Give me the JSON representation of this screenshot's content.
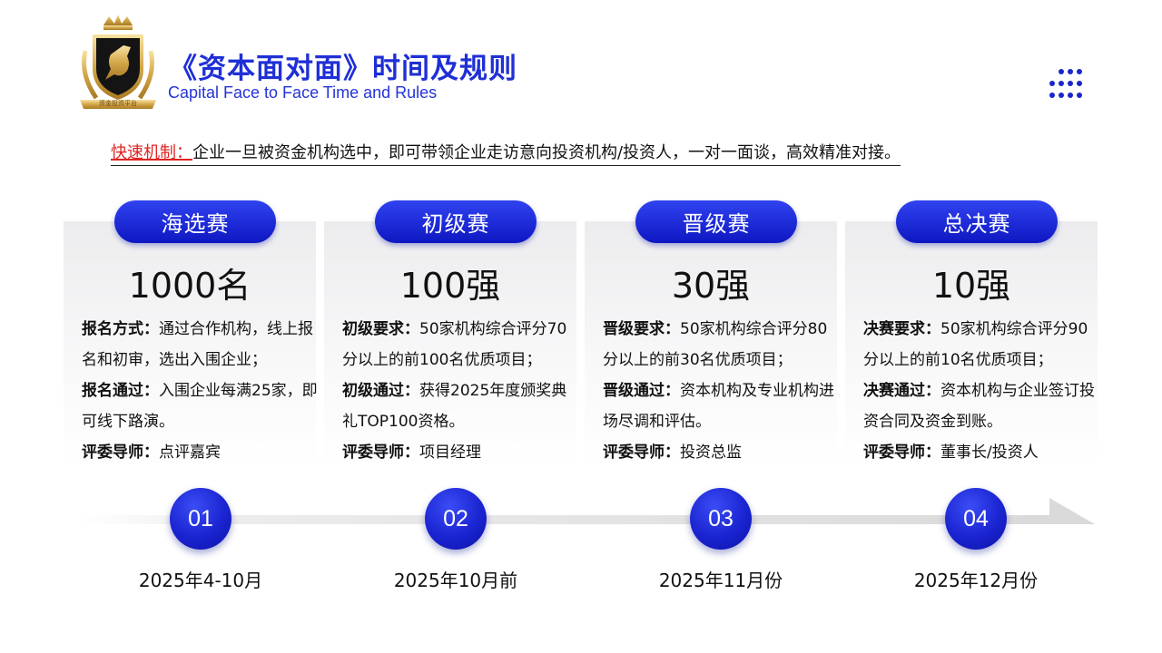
{
  "header": {
    "title": "《资本面对面》时间及规则",
    "subtitle": "Capital Face to Face Time and Rules",
    "logo_text": "资金投资平台"
  },
  "intro": {
    "label": "快速机制：",
    "text": "企业一旦被资金机构选中，即可带领企业走访意向投资机构/投资人，一对一面谈，高效精准对接。"
  },
  "colors": {
    "accent": "#1f2fd6",
    "pill": "#1a26c9",
    "highlight": "#e02424"
  },
  "stages": [
    {
      "name": "海选赛",
      "count": "1000名",
      "lines": [
        {
          "label": "报名方式：",
          "text": "通过合作机构，线上报名和初审，选出入围企业；"
        },
        {
          "label": "报名通过：",
          "text": "入围企业每满25家，即可线下路演。"
        },
        {
          "label": "评委导师：",
          "text": "点评嘉宾"
        }
      ],
      "number": "01",
      "date": "2025年4-10月"
    },
    {
      "name": "初级赛",
      "count": "100强",
      "lines": [
        {
          "label": "初级要求：",
          "text": "50家机构综合评分70分以上的前100名优质项目；"
        },
        {
          "label": "初级通过：",
          "text": "获得2025年度颁奖典礼TOP100资格。"
        },
        {
          "label": "评委导师：",
          "text": "项目经理"
        }
      ],
      "number": "02",
      "date": "2025年10月前"
    },
    {
      "name": "晋级赛",
      "count": "30强",
      "lines": [
        {
          "label": "晋级要求：",
          "text": "50家机构综合评分80分以上的前30名优质项目；"
        },
        {
          "label": "晋级通过：",
          "text": "资本机构及专业机构进场尽调和评估。"
        },
        {
          "label": "评委导师：",
          "text": "投资总监"
        }
      ],
      "number": "03",
      "date": "2025年11月份"
    },
    {
      "name": "总决赛",
      "count": "10强",
      "lines": [
        {
          "label": "决赛要求：",
          "text": "50家机构综合评分90分以上的前10名优质项目；"
        },
        {
          "label": "决赛通过：",
          "text": "资本机构与企业签订投资合同及资金到账。"
        },
        {
          "label": "评委导师：",
          "text": "董事长/投资人"
        }
      ],
      "number": "04",
      "date": "2025年12月份"
    }
  ]
}
